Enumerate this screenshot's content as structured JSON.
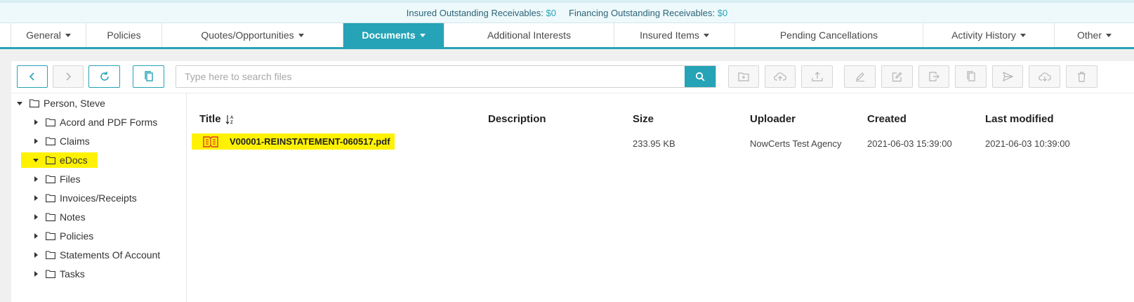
{
  "banner": {
    "insured_label": "Insured Outstanding Receivables:",
    "insured_amount": "$0",
    "financing_label": "Financing Outstanding Receivables:",
    "financing_amount": "$0"
  },
  "tabs": [
    {
      "label": "General",
      "dropdown": true
    },
    {
      "label": "Policies",
      "dropdown": false
    },
    {
      "label": "Quotes/Opportunities",
      "dropdown": true
    },
    {
      "label": "Documents",
      "dropdown": true,
      "active": true
    },
    {
      "label": "Additional Interests",
      "dropdown": false
    },
    {
      "label": "Insured Items",
      "dropdown": true
    },
    {
      "label": "Pending Cancellations",
      "dropdown": false
    },
    {
      "label": "Activity History",
      "dropdown": true
    },
    {
      "label": "Other",
      "dropdown": true
    }
  ],
  "toolbar": {
    "search_placeholder": "Type here to search files",
    "icons": [
      "chevron-left-icon",
      "chevron-right-icon",
      "refresh-icon",
      "copy-icon",
      "search-icon",
      "new-folder-icon",
      "upload-cloud-icon",
      "upload-icon",
      "rename-icon",
      "edit-icon",
      "move-icon",
      "copy-icon",
      "send-icon",
      "download-cloud-icon",
      "trash-icon"
    ]
  },
  "tree": {
    "root": "Person, Steve",
    "children": [
      "Acord and PDF Forms",
      "Claims",
      "eDocs",
      "Files",
      "Invoices/Receipts",
      "Notes",
      "Policies",
      "Statements Of Account",
      "Tasks"
    ],
    "selected": "eDocs"
  },
  "table": {
    "headers": {
      "title": "Title",
      "description": "Description",
      "size": "Size",
      "uploader": "Uploader",
      "created": "Created",
      "modified": "Last modified"
    },
    "rows": [
      {
        "title": "V00001-REINSTATEMENT-060517.pdf",
        "description": "",
        "size": "233.95 KB",
        "uploader": "NowCerts Test Agency",
        "created": "2021-06-03 15:39:00",
        "modified": "2021-06-03 10:39:00"
      }
    ]
  },
  "colors": {
    "accent": "#26a3b6",
    "highlight": "#fff200",
    "pdf_icon": "#e0362c"
  }
}
